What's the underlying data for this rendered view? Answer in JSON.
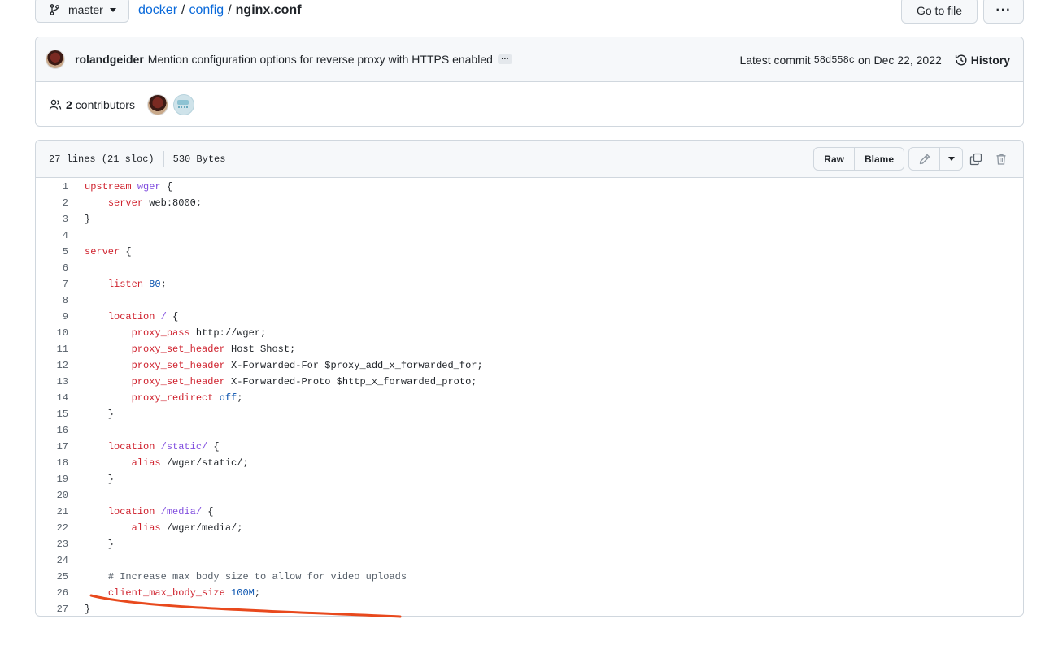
{
  "topbar": {
    "branch": "master",
    "breadcrumb": [
      "docker",
      "config"
    ],
    "current_file": "nginx.conf",
    "goto_label": "Go to file",
    "more_label": "···"
  },
  "commit": {
    "author": "rolandgeider",
    "message": "Mention configuration options for reverse proxy with HTTPS enabled",
    "ellipsis": "…",
    "latest_label": "Latest commit",
    "sha": "58d558c",
    "date": "on Dec 22, 2022",
    "history_label": "History"
  },
  "contributors": {
    "count": "2",
    "label": "contributors"
  },
  "file": {
    "lines_info": "27 lines (21 sloc)",
    "size": "530 Bytes",
    "raw_label": "Raw",
    "blame_label": "Blame"
  },
  "code_lines": [
    [
      [
        "k",
        "upstream"
      ],
      [
        "t",
        " "
      ],
      [
        "e",
        "wger"
      ],
      [
        "t",
        " {"
      ]
    ],
    [
      [
        "t",
        "    "
      ],
      [
        "k",
        "server"
      ],
      [
        "t",
        " web:8000;"
      ]
    ],
    [
      [
        "t",
        "}"
      ]
    ],
    [],
    [
      [
        "k",
        "server"
      ],
      [
        "t",
        " {"
      ]
    ],
    [],
    [
      [
        "t",
        "    "
      ],
      [
        "k",
        "listen"
      ],
      [
        "t",
        " "
      ],
      [
        "n",
        "80"
      ],
      [
        "t",
        ";"
      ]
    ],
    [],
    [
      [
        "t",
        "    "
      ],
      [
        "k",
        "location"
      ],
      [
        "t",
        " "
      ],
      [
        "e",
        "/"
      ],
      [
        "t",
        " {"
      ]
    ],
    [
      [
        "t",
        "        "
      ],
      [
        "k",
        "proxy_pass"
      ],
      [
        "t",
        " http://wger;"
      ]
    ],
    [
      [
        "t",
        "        "
      ],
      [
        "k",
        "proxy_set_header"
      ],
      [
        "t",
        " Host $host;"
      ]
    ],
    [
      [
        "t",
        "        "
      ],
      [
        "k",
        "proxy_set_header"
      ],
      [
        "t",
        " X-Forwarded-For $proxy_add_x_forwarded_for;"
      ]
    ],
    [
      [
        "t",
        "        "
      ],
      [
        "k",
        "proxy_set_header"
      ],
      [
        "t",
        " X-Forwarded-Proto $http_x_forwarded_proto;"
      ]
    ],
    [
      [
        "t",
        "        "
      ],
      [
        "k",
        "proxy_redirect"
      ],
      [
        "t",
        " "
      ],
      [
        "n",
        "off"
      ],
      [
        "t",
        ";"
      ]
    ],
    [
      [
        "t",
        "    }"
      ]
    ],
    [],
    [
      [
        "t",
        "    "
      ],
      [
        "k",
        "location"
      ],
      [
        "t",
        " "
      ],
      [
        "e",
        "/static/"
      ],
      [
        "t",
        " {"
      ]
    ],
    [
      [
        "t",
        "        "
      ],
      [
        "k",
        "alias"
      ],
      [
        "t",
        " /wger/static/;"
      ]
    ],
    [
      [
        "t",
        "    }"
      ]
    ],
    [],
    [
      [
        "t",
        "    "
      ],
      [
        "k",
        "location"
      ],
      [
        "t",
        " "
      ],
      [
        "e",
        "/media/"
      ],
      [
        "t",
        " {"
      ]
    ],
    [
      [
        "t",
        "        "
      ],
      [
        "k",
        "alias"
      ],
      [
        "t",
        " /wger/media/;"
      ]
    ],
    [
      [
        "t",
        "    }"
      ]
    ],
    [],
    [
      [
        "t",
        "    "
      ],
      [
        "c",
        "# Increase max body size to allow for video uploads"
      ]
    ],
    [
      [
        "t",
        "    "
      ],
      [
        "k",
        "client_max_body_size"
      ],
      [
        "t",
        " "
      ],
      [
        "n",
        "100M"
      ],
      [
        "t",
        ";"
      ]
    ],
    [
      [
        "t",
        "}"
      ]
    ]
  ],
  "colors": {
    "keyword": "#cf222e",
    "entity": "#8250df",
    "number": "#0550ae",
    "comment": "#57606a",
    "annotation": "#e8491d"
  }
}
